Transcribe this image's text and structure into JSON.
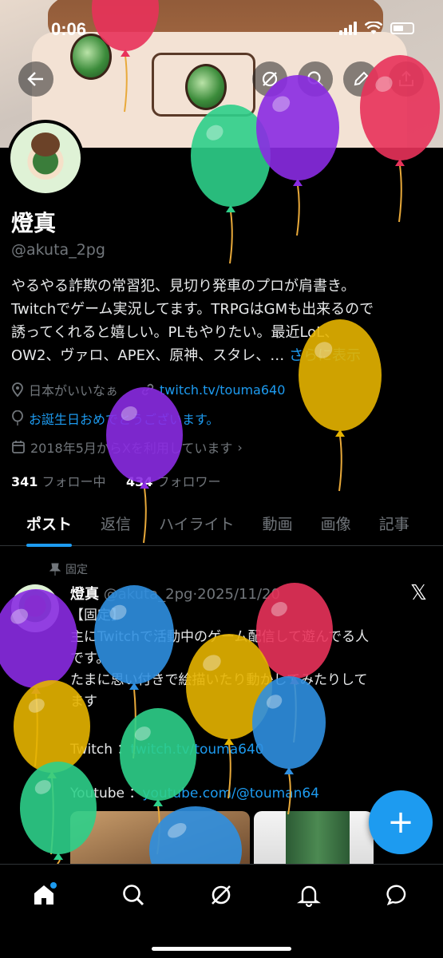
{
  "status_bar": {
    "time": "0:06"
  },
  "profile": {
    "display_name": "燈真",
    "handle": "@akuta_2pg",
    "bio_lines": [
      "やるやる詐欺の常習犯、見切り発車のプロが肩書き。",
      "Twitchでゲーム実況してます。TRPGはGMも出来るので",
      "誘ってくれると嬉しい。PLもやりたい。最近LoL、",
      "OW2、ヴァロ、APEX、原神、スタレ、…"
    ],
    "bio_more": "さらに表示",
    "location": "日本がいいなぁ",
    "website": "twitch.tv/touma640",
    "birthday": "お誕生日おめでとうございます。",
    "joined": "2018年5月からXを利用しています",
    "following_count": "341",
    "following_label": "フォロー中",
    "followers_count": "434",
    "followers_label": "フォロワー"
  },
  "tabs": [
    "ポスト",
    "返信",
    "ハイライト",
    "動画",
    "画像",
    "記事"
  ],
  "pinned_post": {
    "pinned_label": "固定",
    "author_name": "燈真",
    "author_handle": "@akuta_2pg",
    "date": "2025/11/20",
    "body_lines": [
      "【固定】",
      "主にTwitchで活動中のゲーム配信して遊んでる人",
      "です。",
      "たまに思い付きで絵描いたり動かしてみたりして",
      "ます"
    ],
    "twitch_label": "Twitch ：",
    "twitch_link": "twitch.tv/touma640",
    "youtube_label": "Youtube ：",
    "youtube_link": "youtube.com/@touman64"
  },
  "compose_button": "+",
  "icons": {
    "back": "back-arrow-icon",
    "grok": "grok-icon",
    "search": "search-icon",
    "edit": "edit-icon",
    "share": "share-icon",
    "location": "location-pin-icon",
    "link": "link-icon",
    "birthday": "balloon-icon",
    "calendar": "calendar-icon",
    "pin": "pin-icon",
    "x_logo": "x-logo-icon",
    "nav_home": "home-icon",
    "nav_search": "search-icon",
    "nav_grok": "grok-icon",
    "nav_notifications": "bell-icon",
    "nav_messages": "chat-icon"
  },
  "colors": {
    "accent": "#1d9bf0",
    "background": "#000000",
    "muted_text": "#71767b",
    "balloon_red": "#e8325a",
    "balloon_purple": "#8a2be2",
    "balloon_green": "#2ecf8a",
    "balloon_yellow": "#e6b400",
    "balloon_blue": "#2f8fe0"
  }
}
